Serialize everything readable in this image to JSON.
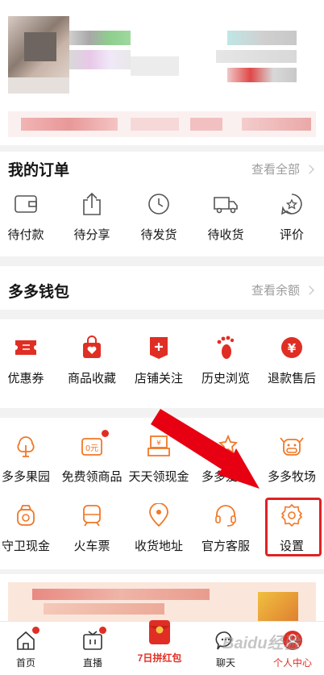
{
  "orders": {
    "title": "我的订单",
    "more": "查看全部",
    "items": [
      {
        "label": "待付款",
        "icon": "wallet-icon"
      },
      {
        "label": "待分享",
        "icon": "share-icon"
      },
      {
        "label": "待发货",
        "icon": "clock-icon"
      },
      {
        "label": "待收货",
        "icon": "truck-icon"
      },
      {
        "label": "评价",
        "icon": "review-icon"
      }
    ]
  },
  "wallet": {
    "title": "多多钱包",
    "more": "查看余额"
  },
  "shortcuts": [
    {
      "label": "优惠券",
      "icon": "coupon-icon"
    },
    {
      "label": "商品收藏",
      "icon": "favorite-bag-icon"
    },
    {
      "label": "店铺关注",
      "icon": "shop-follow-icon"
    },
    {
      "label": "历史浏览",
      "icon": "footprint-icon"
    },
    {
      "label": "退款售后",
      "icon": "refund-icon"
    }
  ],
  "services_row1": [
    {
      "label": "多多果园",
      "icon": "tree-icon",
      "badge": false
    },
    {
      "label": "免费领商品",
      "icon": "free-goods-icon",
      "badge": true
    },
    {
      "label": "天天领现金",
      "icon": "cash-icon",
      "badge": true
    },
    {
      "label": "多多爱消",
      "icon": "game-icon",
      "badge": false
    },
    {
      "label": "多多牧场",
      "icon": "cow-icon",
      "badge": false
    }
  ],
  "services_row2": [
    {
      "label": "守卫现金",
      "icon": "guard-cash-icon"
    },
    {
      "label": "火车票",
      "icon": "train-icon"
    },
    {
      "label": "收货地址",
      "icon": "location-icon"
    },
    {
      "label": "官方客服",
      "icon": "headset-icon"
    },
    {
      "label": "设置",
      "icon": "settings-icon"
    }
  ],
  "tabs": [
    {
      "label": "首页",
      "icon": "home-icon"
    },
    {
      "label": "直播",
      "icon": "live-tv-icon"
    },
    {
      "label": "7日拼红包",
      "icon": "red-packet-icon"
    },
    {
      "label": "聊天",
      "icon": "chat-icon"
    },
    {
      "label": "个人中心",
      "icon": "profile-icon"
    }
  ],
  "watermark": "Baidu经验",
  "colors": {
    "accent": "#e02e24",
    "orange": "#f07828",
    "highlight": "#e02222"
  }
}
